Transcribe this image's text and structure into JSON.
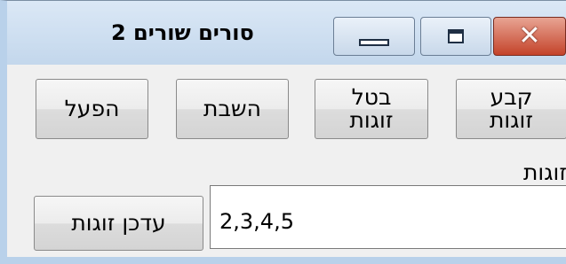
{
  "window": {
    "title": "סורים שורים 2",
    "minimize_glyph": "minimize-icon",
    "maximize_glyph": "maximize-icon",
    "close_glyph": "✕"
  },
  "buttons": {
    "set_pairs": "קבע\nזוגות",
    "cancel_pairs": "בטל\nזוגות",
    "pause": "השבת",
    "run": "הפעל",
    "update_pairs": "עדכן זוגות"
  },
  "pairs": {
    "label": "זוגות",
    "value": "2,3,4,5"
  }
}
